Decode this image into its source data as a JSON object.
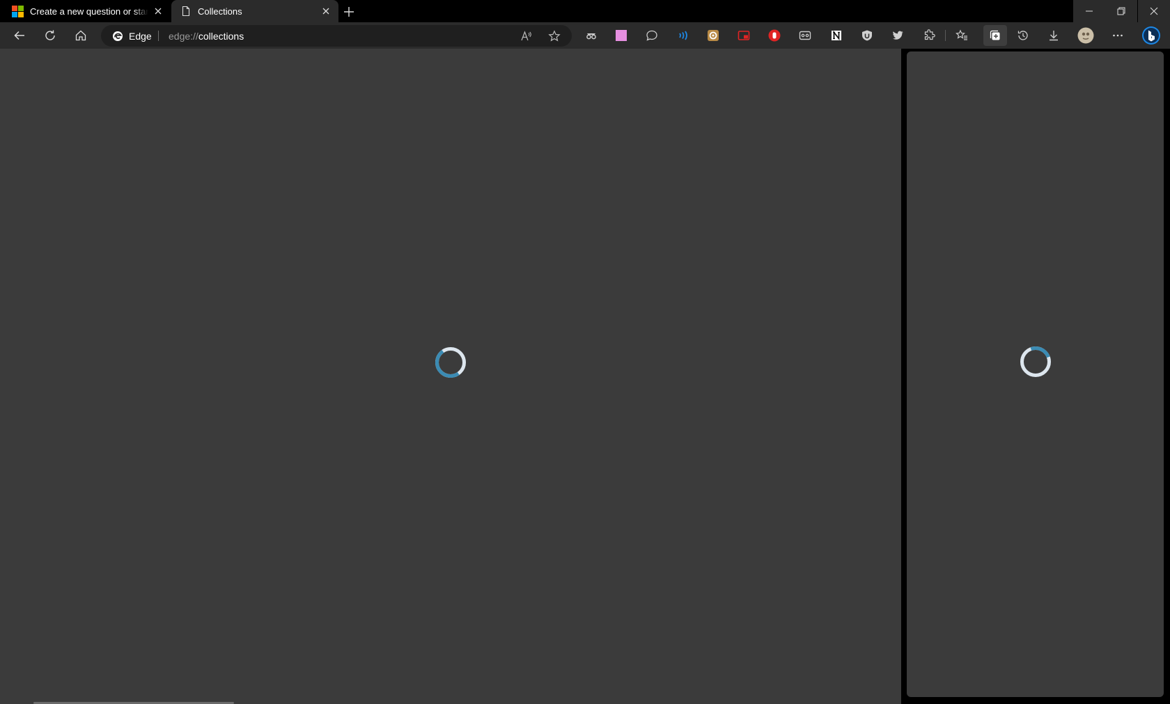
{
  "tabs": [
    {
      "title": "Create a new question or start a discussion",
      "favicon": "microsoft-logo-icon",
      "active": false
    },
    {
      "title": "Collections",
      "favicon": "page-icon",
      "active": true
    }
  ],
  "toolbar": {
    "site_label": "Edge",
    "url_scheme": "edge://",
    "url_host": "collections",
    "extensions": [
      "spy-glasses-icon",
      "pink-square-icon",
      "chat-bubble-icon",
      "wave-icon",
      "gear-badge-icon",
      "picture-in-picture-icon",
      "stop-hand-icon",
      "cassette-icon",
      "notion-icon",
      "ublock-shield-icon",
      "twitter-bird-icon"
    ]
  },
  "colors": {
    "content_bg": "#3b3b3b",
    "toolbar_bg": "#2b2b2b",
    "spinner_accent": "#3b8bb3",
    "bing_accent": "#1e88e5"
  }
}
